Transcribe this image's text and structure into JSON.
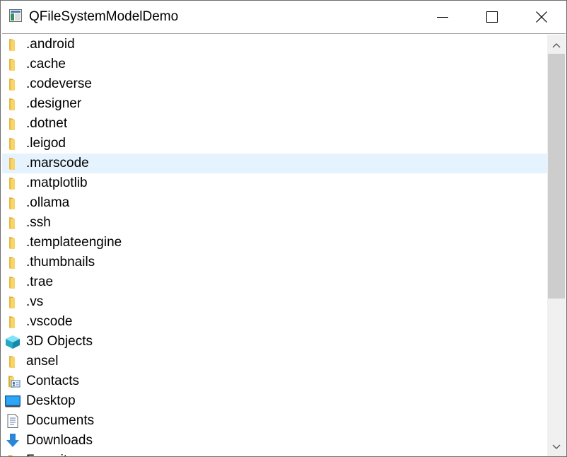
{
  "window": {
    "title": "QFileSystemModelDemo",
    "app_icon": "qt-app-icon",
    "controls": {
      "minimize_icon": "minimize-icon",
      "maximize_icon": "maximize-icon",
      "close_icon": "close-icon"
    }
  },
  "tree": {
    "hovered_item": ".marscode",
    "items": [
      {
        "label": ".android",
        "icon": "folder-icon"
      },
      {
        "label": ".cache",
        "icon": "folder-icon"
      },
      {
        "label": ".codeverse",
        "icon": "folder-icon"
      },
      {
        "label": ".designer",
        "icon": "folder-icon"
      },
      {
        "label": ".dotnet",
        "icon": "folder-icon"
      },
      {
        "label": ".leigod",
        "icon": "folder-icon"
      },
      {
        "label": ".marscode",
        "icon": "folder-icon"
      },
      {
        "label": ".matplotlib",
        "icon": "folder-icon"
      },
      {
        "label": ".ollama",
        "icon": "folder-icon"
      },
      {
        "label": ".ssh",
        "icon": "folder-icon"
      },
      {
        "label": ".templateengine",
        "icon": "folder-icon"
      },
      {
        "label": ".thumbnails",
        "icon": "folder-icon"
      },
      {
        "label": ".trae",
        "icon": "folder-icon"
      },
      {
        "label": ".vs",
        "icon": "folder-icon"
      },
      {
        "label": ".vscode",
        "icon": "folder-icon"
      },
      {
        "label": "3D Objects",
        "icon": "3d-objects-icon"
      },
      {
        "label": "ansel",
        "icon": "folder-icon"
      },
      {
        "label": "Contacts",
        "icon": "contacts-icon"
      },
      {
        "label": "Desktop",
        "icon": "desktop-icon"
      },
      {
        "label": "Documents",
        "icon": "documents-icon"
      },
      {
        "label": "Downloads",
        "icon": "downloads-icon"
      },
      {
        "label": "Favorites",
        "icon": "favorites-icon"
      }
    ]
  },
  "scrollbar": {
    "up_icon": "scroll-up-arrow-icon",
    "down_icon": "scroll-down-arrow-icon",
    "visible_fraction": 0.6,
    "position": 0.0
  },
  "colors": {
    "hover_background": "#e5f3ff",
    "folder_yellow": "#f5c94b",
    "scrollbar_track": "#f0f0f0",
    "scrollbar_thumb": "#cdcdcd"
  }
}
